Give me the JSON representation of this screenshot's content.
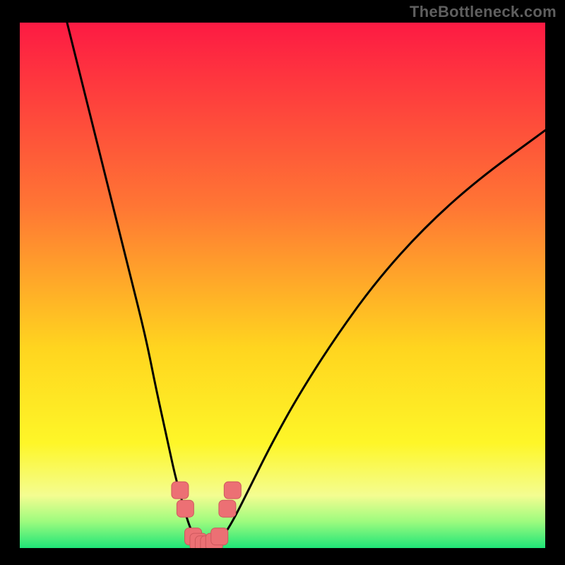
{
  "attribution": "TheBottleneck.com",
  "colors": {
    "background": "#000000",
    "gradient_top": "#fd1a43",
    "gradient_mid_upper": "#ff7634",
    "gradient_mid": "#ffd51f",
    "gradient_mid_lower": "#fef628",
    "gradient_band_light": "#f4fd91",
    "gradient_green_light": "#9cfb7e",
    "gradient_green": "#1fe578",
    "curve": "#000000",
    "marker_fill": "#ec7074",
    "marker_stroke": "#cd585d"
  },
  "chart_data": {
    "type": "line",
    "title": "",
    "xlabel": "",
    "ylabel": "",
    "xlim": [
      0,
      100
    ],
    "ylim": [
      0,
      100
    ],
    "series": [
      {
        "name": "bottleneck-curve",
        "type": "line",
        "x": [
          9,
          12,
          15,
          18,
          21,
          24,
          26,
          28,
          29.5,
          31,
          32,
          33,
          34,
          35,
          36,
          37.5,
          39,
          41,
          44,
          48,
          53,
          60,
          68,
          77,
          87,
          100
        ],
        "y": [
          100,
          88,
          76,
          64,
          52,
          40,
          30,
          21,
          14,
          8.5,
          5,
          2.5,
          1.2,
          0.7,
          0.7,
          1.2,
          2.6,
          6,
          12,
          20,
          29,
          40,
          51,
          61,
          70,
          79.5
        ]
      },
      {
        "name": "markers",
        "type": "scatter",
        "x": [
          30.5,
          31.5,
          33,
          34,
          35,
          36,
          37,
          38,
          39.5,
          40.5
        ],
        "y": [
          11,
          7.5,
          2.2,
          1.2,
          0.7,
          0.7,
          1.2,
          2.2,
          7.5,
          11
        ]
      }
    ]
  }
}
